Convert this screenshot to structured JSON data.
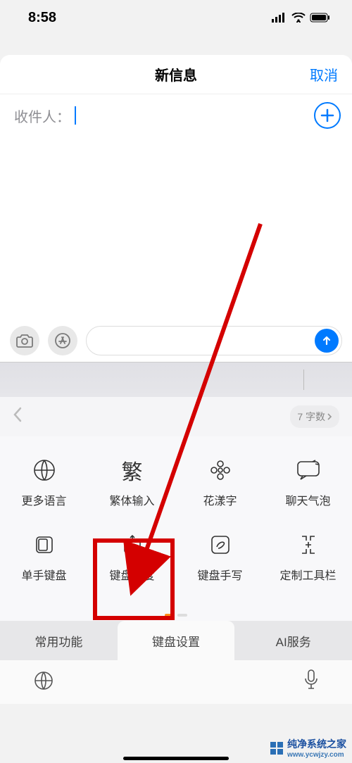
{
  "status": {
    "time": "8:58"
  },
  "nav": {
    "title": "新信息",
    "cancel": "取消"
  },
  "recipient": {
    "label": "收件人：",
    "add": "+"
  },
  "wordcount": {
    "text": "7 字数"
  },
  "grid_row1": [
    {
      "label": "更多语言"
    },
    {
      "label": "繁体输入"
    },
    {
      "label": "花漾字"
    },
    {
      "label": "聊天气泡"
    }
  ],
  "grid_row2": [
    {
      "label": "单手键盘"
    },
    {
      "label": "键盘高度"
    },
    {
      "label": "键盘手写"
    },
    {
      "label": "定制工具栏"
    }
  ],
  "tabs": [
    {
      "label": "常用功能"
    },
    {
      "label": "键盘设置"
    },
    {
      "label": "AI服务"
    }
  ],
  "watermark": {
    "text": "纯净系统之家",
    "url": "www.ycwjzy.com"
  },
  "traditional_char": "繁"
}
